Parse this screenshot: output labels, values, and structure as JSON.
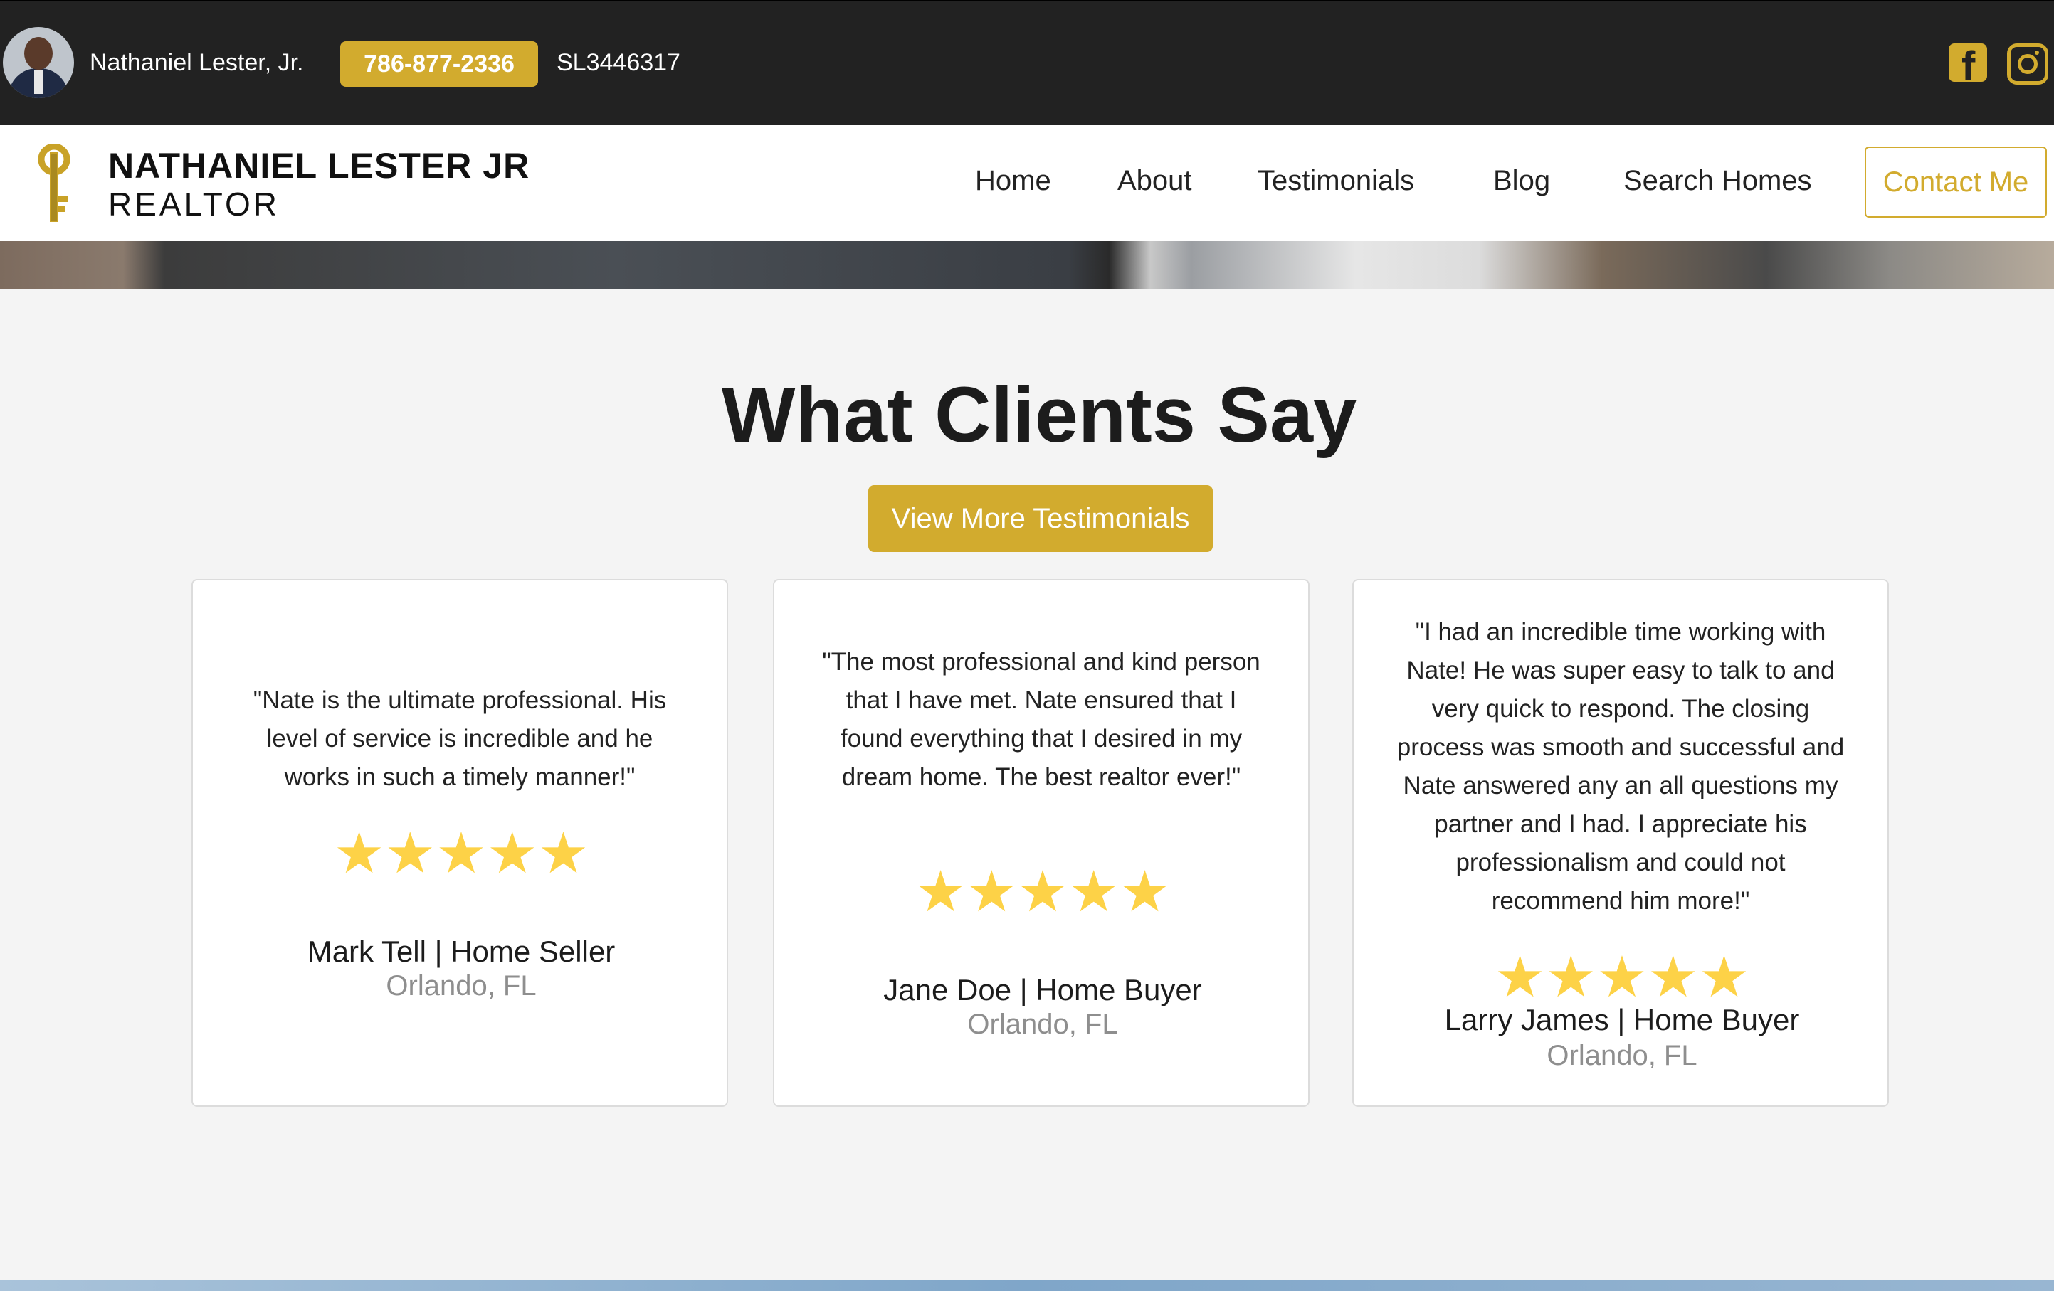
{
  "topbar": {
    "agent_name": "Nathaniel Lester, Jr.",
    "phone": "786-877-2336",
    "license": "SL3446317",
    "social": [
      "facebook-icon",
      "instagram-icon"
    ],
    "accent_color": "#d2ab2e"
  },
  "brand": {
    "line1": "NATHANIEL LESTER JR",
    "line2": "REALTOR"
  },
  "nav": {
    "items": [
      "Home",
      "About",
      "Testimonials",
      "Blog",
      "Search Homes"
    ],
    "contact": "Contact Me"
  },
  "testimonials": {
    "title": "What Clients Say",
    "button": "View More Testimonials",
    "star_color": "#fdd247",
    "cards": [
      {
        "quote": "\"Nate is the ultimate professional. His level of service is incredible and he works in such a timely manner!\"",
        "rating": 5,
        "reviewer": "Mark Tell | Home Seller",
        "location": "Orlando, FL"
      },
      {
        "quote": "\"The most professional and kind person that I have met. Nate ensured that I found everything that I desired in my dream home. The best realtor ever!\"",
        "rating": 5,
        "reviewer": "Jane Doe | Home Buyer",
        "location": "Orlando, FL"
      },
      {
        "quote": "\"I had an incredible time working with Nate! He was super easy to talk to and very quick to respond. The closing process was smooth and successful and Nate answered any an all questions my partner and I had. I appreciate his professionalism and could not recommend him more!\"",
        "rating": 5,
        "reviewer": "Larry James | Home Buyer",
        "location": "Orlando, FL"
      }
    ]
  }
}
